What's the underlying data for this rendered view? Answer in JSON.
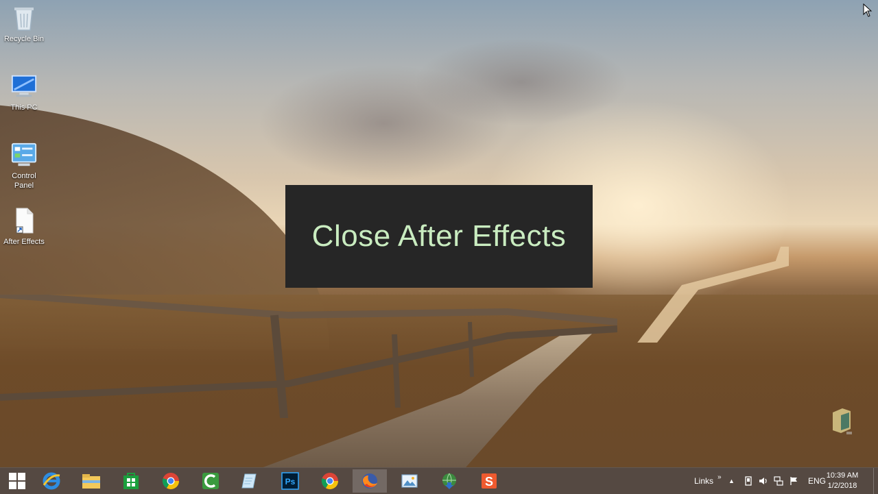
{
  "desktop": {
    "icons": [
      {
        "label": "Recycle Bin",
        "icon": "recycle-bin-icon"
      },
      {
        "label": "This PC",
        "icon": "computer-icon"
      },
      {
        "label": "Control Panel",
        "icon": "control-panel-icon"
      },
      {
        "label": "After Effects",
        "icon": "shortcut-file-icon"
      }
    ]
  },
  "overlay": {
    "text": "Close After Effects"
  },
  "taskbar": {
    "apps": [
      "start-icon",
      "internet-explorer-icon",
      "file-explorer-icon",
      "store-icon",
      "chrome-icon",
      "camtasia-icon",
      "notepad-icon",
      "photoshop-icon",
      "chrome-icon",
      "firefox-icon",
      "photos-icon",
      "globe-download-icon",
      "sublime-icon"
    ],
    "tray": {
      "links_label": "Links",
      "links_chevron": "»",
      "language": "ENG",
      "time": "10:39 AM",
      "date": "1/2/2018"
    }
  },
  "colors": {
    "overlay_bg": "#262626",
    "overlay_text": "#c9ecc0",
    "taskbar_bg": "#463a32"
  }
}
